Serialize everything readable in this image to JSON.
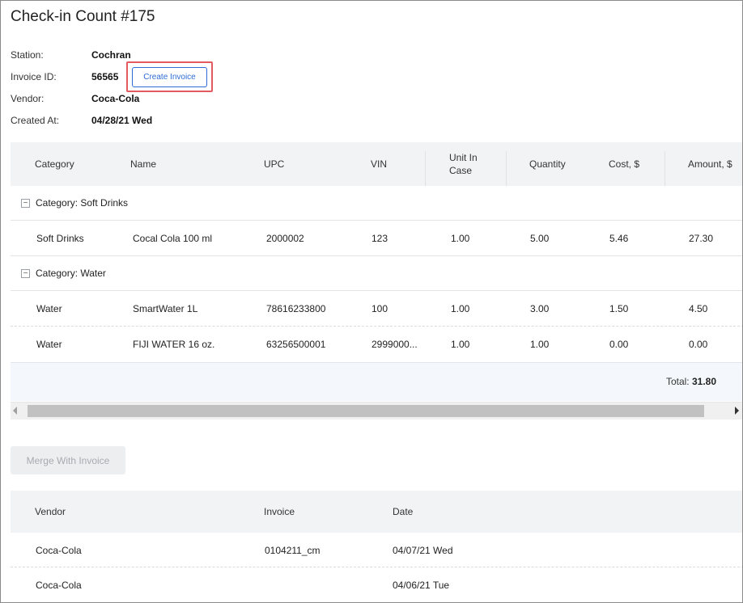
{
  "page": {
    "title": "Check-in Count #175"
  },
  "info": [
    {
      "label": "Station:",
      "value": "Cochran"
    },
    {
      "label": "Invoice ID:",
      "value": "56565"
    },
    {
      "label": "Vendor:",
      "value": "Coca-Cola"
    },
    {
      "label": "Created At:",
      "value": "04/28/21 Wed"
    }
  ],
  "actions": {
    "create_invoice": "Create Invoice",
    "merge_with_invoice": "Merge With Invoice"
  },
  "items_grid": {
    "columns": [
      "Category",
      "Name",
      "UPC",
      "VIN",
      "Unit In Case",
      "Quantity",
      "Cost, $",
      "Amount, $"
    ],
    "groups": [
      {
        "label": "Category: Soft Drinks",
        "rows": [
          [
            "Soft Drinks",
            "Cocal Cola 100 ml",
            "2000002",
            "123",
            "1.00",
            "5.00",
            "5.46",
            "27.30"
          ]
        ]
      },
      {
        "label": "Category: Water",
        "rows": [
          [
            "Water",
            "SmartWater 1L",
            "78616233800",
            "100",
            "1.00",
            "3.00",
            "1.50",
            "4.50"
          ],
          [
            "Water",
            "FIJI WATER 16 oz.",
            "63256500001",
            "2999000...",
            "1.00",
            "1.00",
            "0.00",
            "0.00"
          ]
        ]
      }
    ],
    "total_label": "Total:",
    "total_value": "31.80"
  },
  "invoices_grid": {
    "columns": [
      "Vendor",
      "Invoice",
      "Date"
    ],
    "rows": [
      [
        "Coca-Cola",
        "0104211_cm",
        "04/07/21 Wed"
      ],
      [
        "Coca-Cola",
        "",
        "04/06/21 Tue"
      ]
    ]
  },
  "icons": {
    "collapse": "minus-icon",
    "scroll_left": "arrow-left-icon",
    "scroll_right": "arrow-right-icon"
  },
  "colors": {
    "accent": "#2d6bd6",
    "highlight": "#e35a5f",
    "header_bg": "#f2f3f5",
    "total_bg": "#f4f8fc"
  }
}
